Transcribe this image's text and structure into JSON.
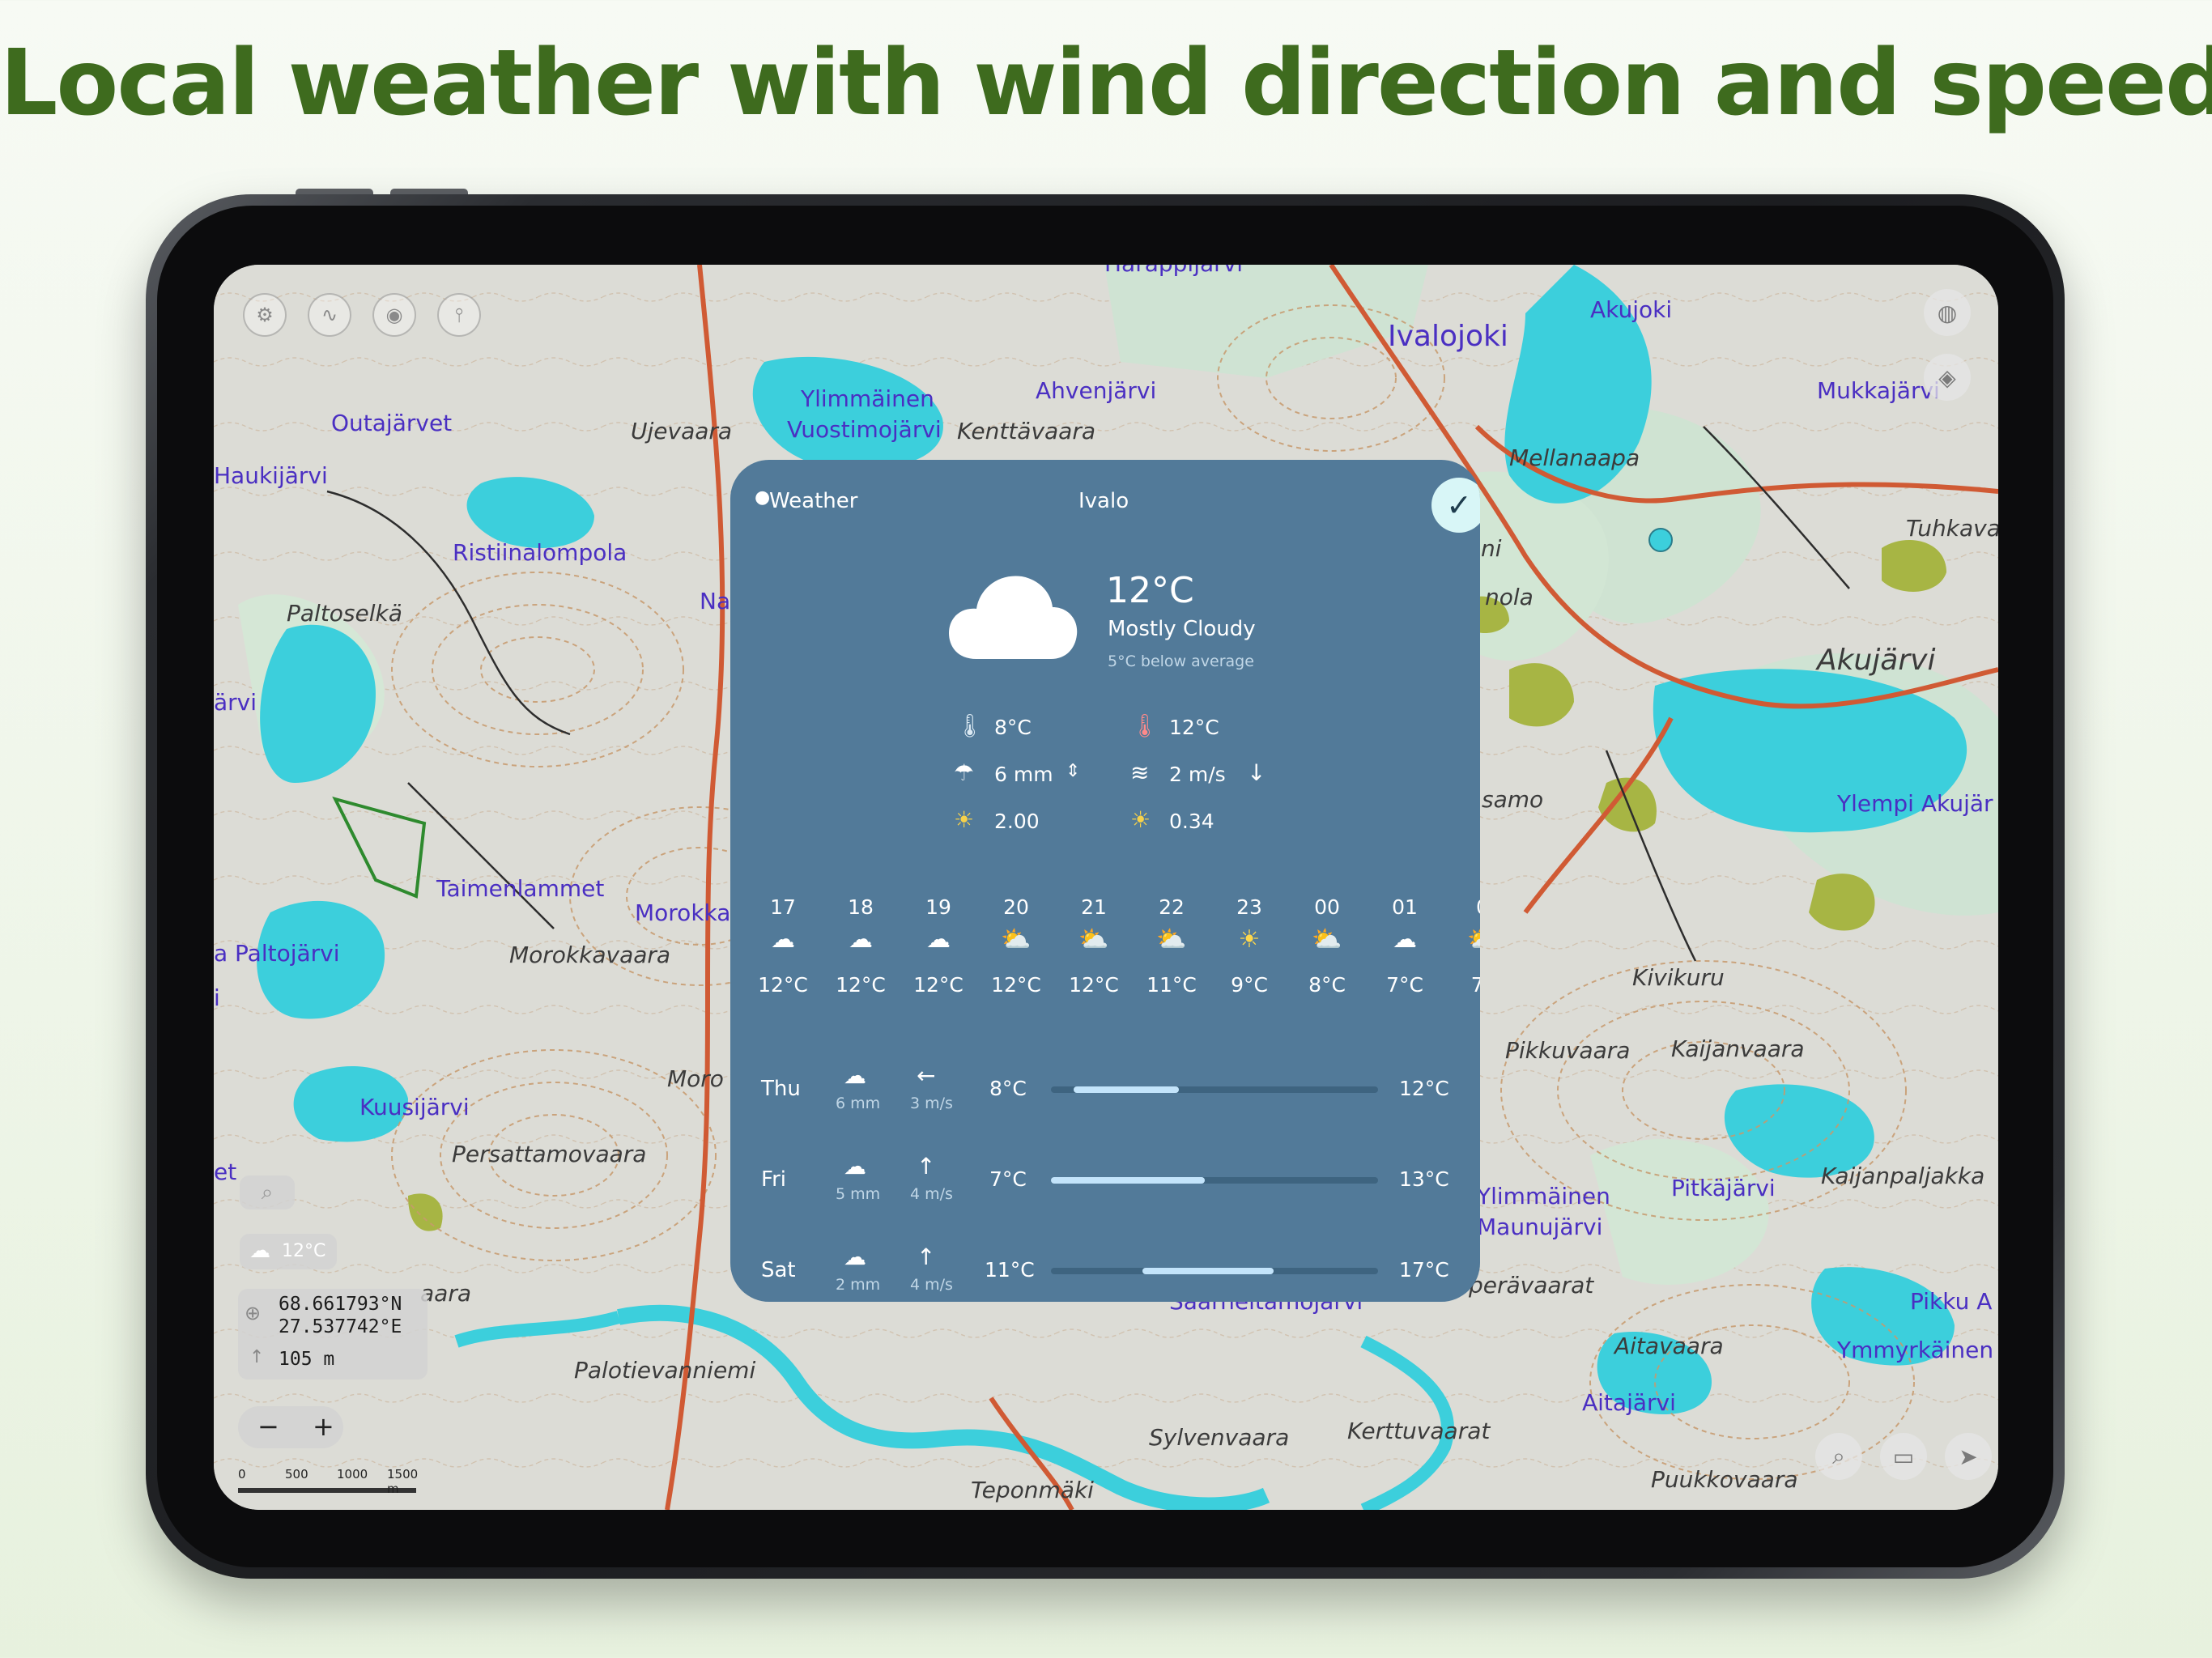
{
  "headline": "Local weather with wind direction and speed",
  "map": {
    "lake_labels": [
      "Harappijärvi",
      "Ivalojoki",
      "Akujoki",
      "Ylimmäinen",
      "Vuostimojärvi",
      "Ahvenjärvi",
      "Outajärvet",
      "Haukijärvi",
      "Ristiinalompola",
      "Na",
      "Mukkajärvi",
      "ärvi",
      "Taimenlammet",
      "Morokka",
      "a Paltojärvi",
      "i",
      "Kuusijärvi",
      "et",
      "Ylimmäinen",
      "Maunujärvi",
      "Pitkäjärvi",
      "Ylempi Akujär",
      "Saarneitamojärvi",
      "Ymmyrkäinen",
      "Aitajärvi",
      "Pikku A"
    ],
    "place_labels": [
      "Ujevaara",
      "Kenttävaara",
      "Mellanaapa",
      "Tuhkava",
      "Paltoselkä",
      "Akujärvi",
      "nola",
      "samo",
      "Morokkavaara",
      "Kivikuru",
      "Moro",
      "Pikkuvaara",
      "Kaijanvaara",
      "Persattamovaara",
      "Kaijanpaljakka",
      "perävaarat",
      "aara",
      "Palotievanniemi",
      "Aitavaara",
      "Sylvenvaara",
      "Kerttuvaarat",
      "Teponmäki",
      "Puukkovaara",
      "ni"
    ]
  },
  "map_controls": {
    "temp_badge": "12°C",
    "latitude": "68.661793°N",
    "longitude": "27.537742°E",
    "altitude": "105 m",
    "zoom_out": "−",
    "zoom_in": "+",
    "scale_labels": [
      "0",
      "500",
      "1000",
      "1500 m"
    ]
  },
  "weather": {
    "provider": "Weather",
    "location": "Ivalo",
    "current_temp": "12°C",
    "condition": "Mostly Cloudy",
    "note": "5°C below average",
    "low": "8°C",
    "high": "12°C",
    "precip": "6 mm",
    "wind": "2 m/s",
    "uv_rise": "2.00",
    "uv_set": "0.34",
    "hourly": [
      {
        "hour": "17",
        "icon": "cloud-icon",
        "temp": "12°C"
      },
      {
        "hour": "18",
        "icon": "cloud-icon",
        "temp": "12°C"
      },
      {
        "hour": "19",
        "icon": "cloud-icon",
        "temp": "12°C"
      },
      {
        "hour": "20",
        "icon": "partly-sunny-icon",
        "temp": "12°C"
      },
      {
        "hour": "21",
        "icon": "partly-sunny-icon",
        "temp": "12°C"
      },
      {
        "hour": "22",
        "icon": "partly-sunny-icon",
        "temp": "11°C"
      },
      {
        "hour": "23",
        "icon": "sun-icon",
        "temp": "9°C"
      },
      {
        "hour": "00",
        "icon": "partly-sunny-icon",
        "temp": "8°C"
      },
      {
        "hour": "01",
        "icon": "night-cloud-icon",
        "temp": "7°C"
      },
      {
        "hour": "0",
        "icon": "partly-sunny-icon",
        "temp": "7°"
      }
    ],
    "daily": [
      {
        "day": "Thu",
        "precip": "6 mm",
        "wind": "3 m/s",
        "wind_arrow": "←",
        "low": "8°C",
        "high": "12°C",
        "bar_start": 0.07,
        "bar_end": 0.39
      },
      {
        "day": "Fri",
        "precip": "5 mm",
        "wind": "4 m/s",
        "wind_arrow": "↑",
        "low": "7°C",
        "high": "13°C",
        "bar_start": 0.0,
        "bar_end": 0.47
      },
      {
        "day": "Sat",
        "precip": "2 mm",
        "wind": "4 m/s",
        "wind_arrow": "↑",
        "low": "11°C",
        "high": "17°C",
        "bar_start": 0.28,
        "bar_end": 0.68
      }
    ]
  },
  "colors": {
    "headline": "#3e6b1e",
    "panel": "#527a99",
    "lake": "#3ccfdc",
    "contour": "#c79a6d",
    "road": "#d05a34"
  }
}
